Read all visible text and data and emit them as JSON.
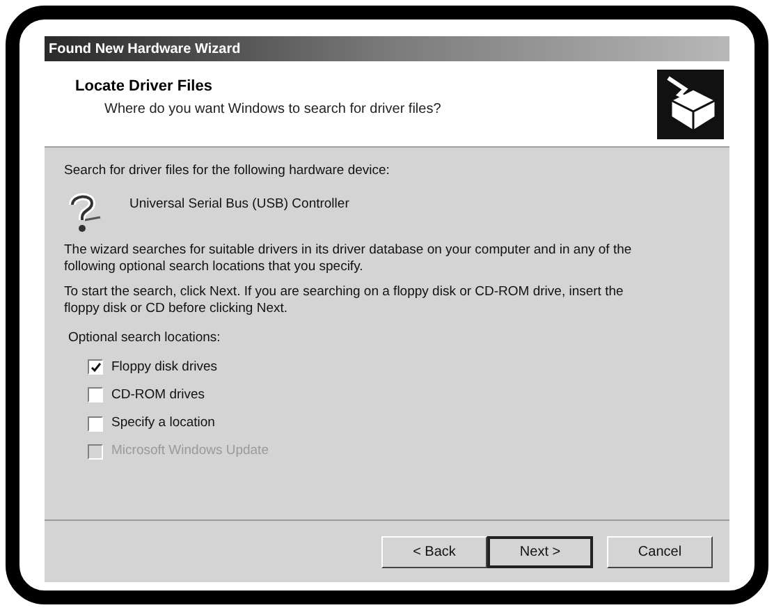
{
  "window": {
    "title": "Found New Hardware Wizard"
  },
  "header": {
    "title": "Locate Driver Files",
    "subtitle": "Where do you want Windows to search for driver files?"
  },
  "body": {
    "intro": "Search for driver files for the following hardware device:",
    "device": "Universal Serial Bus (USB) Controller",
    "paragraphs": [
      "The wizard searches for suitable drivers in its driver database on your computer and in any of the following optional search locations that you specify.",
      "To start the search, click Next. If you are searching on a floppy disk or CD-ROM drive, insert the floppy disk or CD before clicking Next."
    ],
    "options_label": "Optional search locations:",
    "options": [
      {
        "label": "Floppy disk drives",
        "checked": true,
        "disabled": false
      },
      {
        "label": "CD-ROM drives",
        "checked": false,
        "disabled": false
      },
      {
        "label": "Specify a location",
        "checked": false,
        "disabled": false
      },
      {
        "label": "Microsoft Windows Update",
        "checked": false,
        "disabled": true
      }
    ]
  },
  "buttons": [
    {
      "label": "< Back",
      "default": false
    },
    {
      "label": "Next >",
      "default": true
    },
    {
      "label": "Cancel",
      "default": false
    }
  ]
}
